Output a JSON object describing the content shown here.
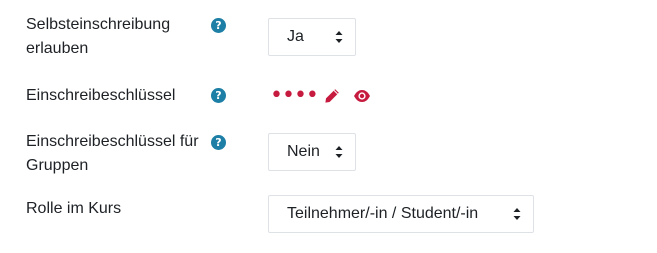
{
  "form": {
    "rows": [
      {
        "label_line1": "Selbsteinschreibung",
        "label_line2": "erlauben",
        "value": "Ja"
      },
      {
        "label_line1": "Einschreibeschlüssel",
        "value": "••••"
      },
      {
        "label_line1": "Einschreibeschlüssel für",
        "label_line2": "Gruppen",
        "value": "Nein"
      },
      {
        "label_line1": "Rolle im Kurs",
        "value": "Teilnehmer/-in / Student/-in"
      }
    ],
    "help_glyph": "?",
    "colors": {
      "help_icon": "#1d7fa6",
      "password_accent": "#c71a3f",
      "text": "#1d2125",
      "border": "#dee2e6"
    },
    "icons": {
      "help": "question-circle-icon",
      "edit": "pencil-icon",
      "reveal": "eye-icon",
      "select": "sort-arrows-icon"
    }
  }
}
